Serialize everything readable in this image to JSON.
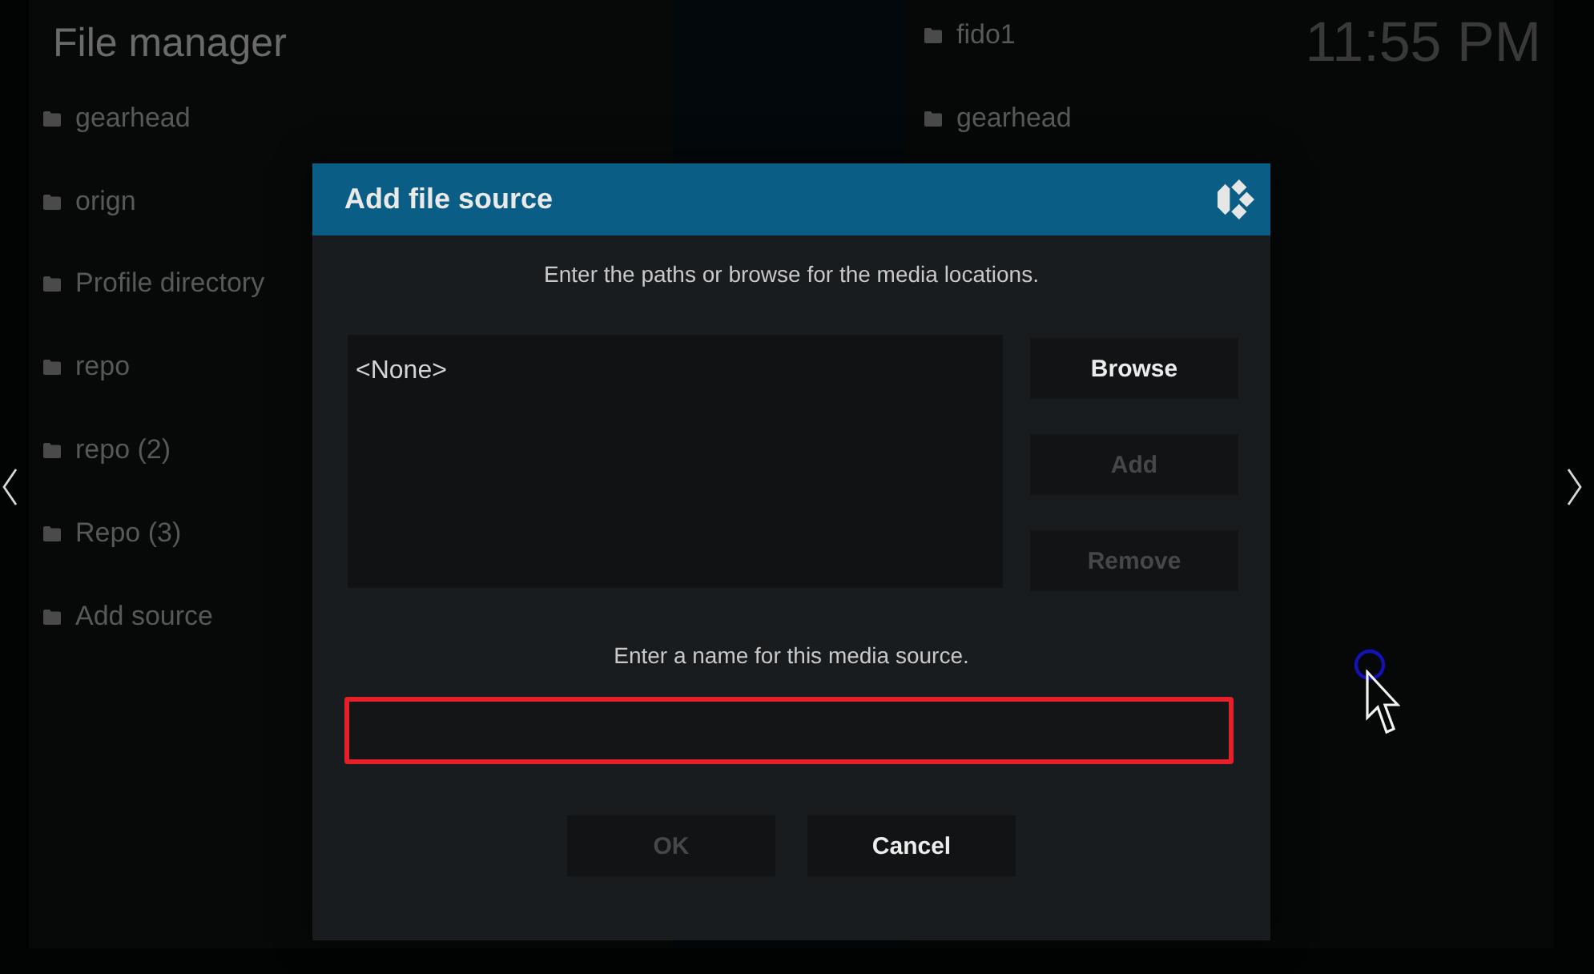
{
  "header": {
    "title": "File manager",
    "clock": "11:55 PM"
  },
  "left_list": {
    "items": [
      {
        "label": "gearhead"
      },
      {
        "label": "orign"
      },
      {
        "label": "Profile directory"
      },
      {
        "label": "repo"
      },
      {
        "label": "repo (2)"
      },
      {
        "label": "Repo (3)"
      },
      {
        "label": "Add source"
      }
    ]
  },
  "right_list": {
    "items": [
      {
        "label": "fido1"
      },
      {
        "label": "gearhead"
      }
    ]
  },
  "dialog": {
    "title": "Add file source",
    "paths_prompt": "Enter the paths or browse for the media locations.",
    "paths": [
      "<None>"
    ],
    "buttons": [
      {
        "label": "Browse",
        "disabled": false
      },
      {
        "label": "Add",
        "disabled": true
      },
      {
        "label": "Remove",
        "disabled": true
      }
    ],
    "name_prompt": "Enter a name for this media source.",
    "name_field": {
      "highlighted": true
    },
    "actions": [
      {
        "label": "OK",
        "disabled": true
      },
      {
        "label": "Cancel",
        "disabled": false
      }
    ]
  }
}
